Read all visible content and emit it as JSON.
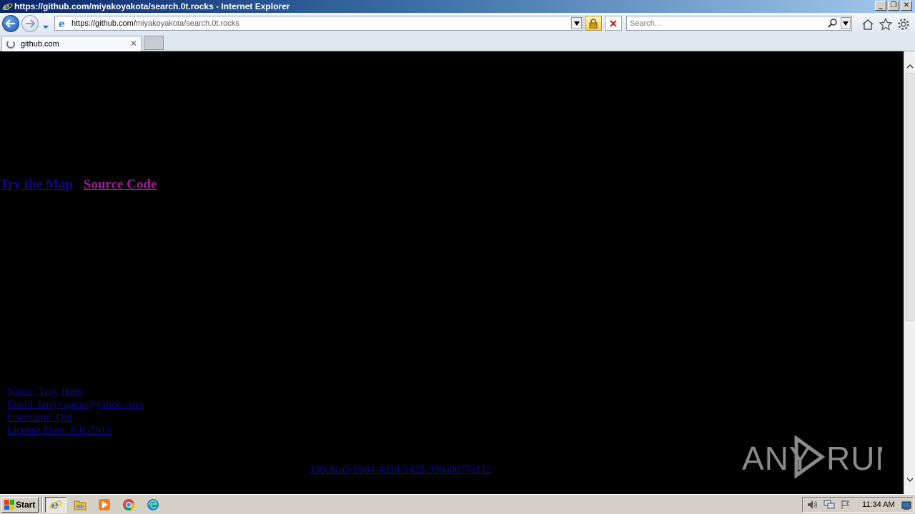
{
  "window": {
    "title": "https://github.com/miyakoyakota/search.0t.rocks - Internet Explorer",
    "controls": [
      "minimize",
      "restore",
      "close"
    ]
  },
  "navbar": {
    "url_host": "https://github.com/",
    "url_rest": "miyakoyakota/search.0t.rocks",
    "search_placeholder": "Search..."
  },
  "tabs": [
    {
      "label": "github.com",
      "loading": true
    }
  ],
  "content": {
    "links": {
      "try_map": "Try the Map",
      "source_code": "Source Code"
    },
    "info": {
      "name": "Name: Troy Hunt",
      "email": "Email: larrycaptns@yahoo.com",
      "username": "Username: Qui",
      "license_plate": "License Plate: KJG7910"
    },
    "uuid": "330c8ca5-6b84-4d14-b425-390a0077e112"
  },
  "watermark": "ANY▷RUN",
  "taskbar": {
    "start_label": "Start",
    "pinned": [
      "internet-explorer",
      "file-explorer",
      "media-player",
      "chrome",
      "edge"
    ],
    "clock": "11:34 AM"
  }
}
